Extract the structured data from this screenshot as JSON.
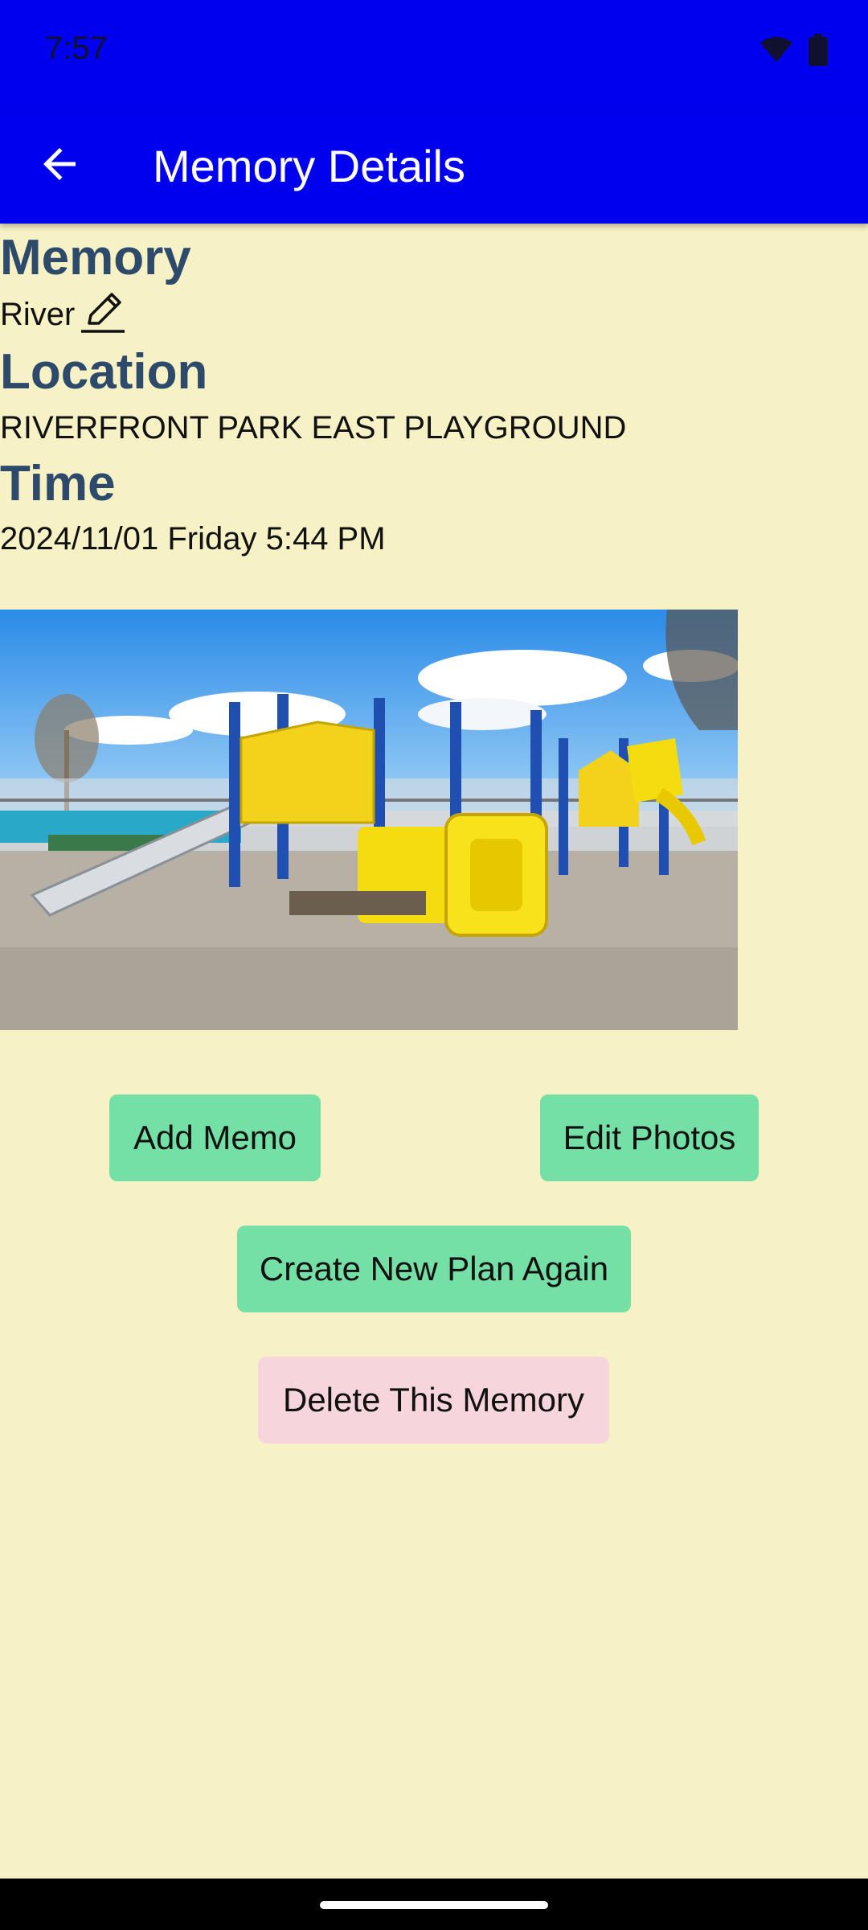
{
  "status_bar": {
    "time": "7:57",
    "icons": [
      "wifi-icon",
      "battery-icon"
    ]
  },
  "app_bar": {
    "title": "Memory Details",
    "back_icon": "arrow-back-icon"
  },
  "memory": {
    "label": "Memory",
    "value": "River",
    "edit_icon": "pencil-icon"
  },
  "location": {
    "label": "Location",
    "value": "RIVERFRONT PARK EAST PLAYGROUND"
  },
  "time": {
    "label": "Time",
    "value": "2024/11/01 Friday 5:44 PM"
  },
  "buttons": {
    "add_memo": "Add Memo",
    "edit_photos": "Edit Photos",
    "create_plan": "Create New Plan Again",
    "delete_memory": "Delete This Memory"
  },
  "colors": {
    "app_bar": "#0000ee",
    "background": "#f7f1c6",
    "section_title": "#2e4a6b",
    "button_green": "#74e0a6",
    "button_pink": "#f6d6dc"
  }
}
